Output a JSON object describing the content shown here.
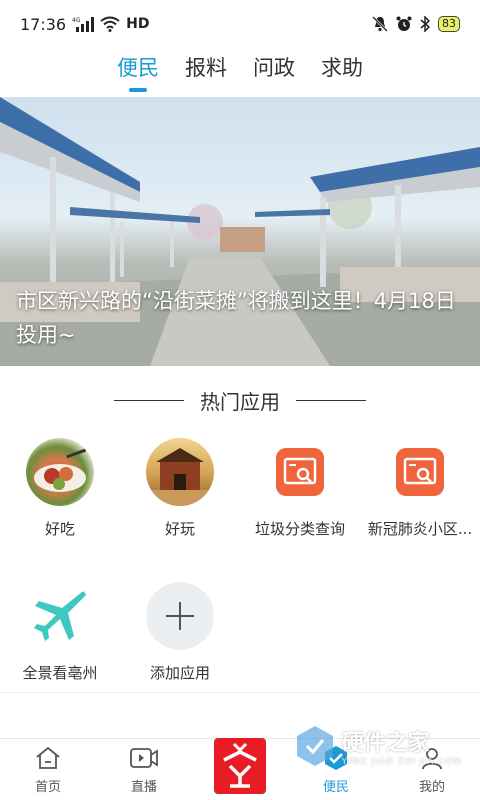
{
  "status_bar": {
    "time": "17:36",
    "network": "4G",
    "hd": "HD",
    "battery": "83"
  },
  "top_tabs": [
    {
      "label": "便民",
      "active": true
    },
    {
      "label": "报料",
      "active": false
    },
    {
      "label": "问政",
      "active": false
    },
    {
      "label": "求助",
      "active": false
    }
  ],
  "banner": {
    "caption": "市区新兴路的“沿街菜摊”将搬到这里！4月18日投用~"
  },
  "section": {
    "title": "热门应用"
  },
  "apps": [
    {
      "label": "好吃",
      "icon": "food-photo-icon"
    },
    {
      "label": "好玩",
      "icon": "temple-photo-icon"
    },
    {
      "label": "垃圾分类查询",
      "icon": "search-card-icon"
    },
    {
      "label": "新冠肺炎小区...",
      "icon": "search-card-icon"
    },
    {
      "label": "全景看亳州",
      "icon": "airplane-icon"
    },
    {
      "label": "添加应用",
      "icon": "plus-icon"
    }
  ],
  "bottom_nav": [
    {
      "label": "首页",
      "icon": "home-icon"
    },
    {
      "label": "直播",
      "icon": "video-icon"
    },
    {
      "label": "",
      "icon": "center-logo"
    },
    {
      "label": "便民",
      "icon": "check-shield-icon",
      "active": true
    },
    {
      "label": "我的",
      "icon": "user-icon"
    }
  ],
  "colors": {
    "accent": "#1a9ad6",
    "orange": "#f0643c",
    "teal": "#3ec8c0",
    "logo_red": "#e81c24"
  },
  "watermark": {
    "text": "硬件之家",
    "sub": "YING JIAN ZHI JIA.COM"
  }
}
